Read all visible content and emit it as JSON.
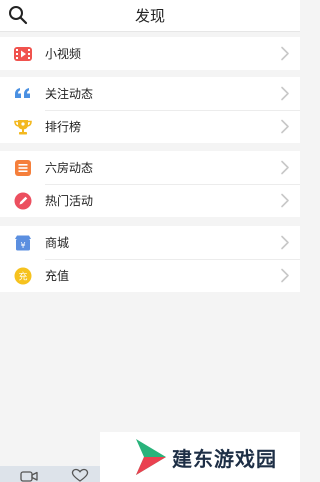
{
  "header": {
    "title": "发现"
  },
  "groups": [
    {
      "items": [
        {
          "label": "小视频",
          "icon": "video-icon"
        }
      ]
    },
    {
      "items": [
        {
          "label": "关注动态",
          "icon": "quote-icon"
        },
        {
          "label": "排行榜",
          "icon": "trophy-icon"
        }
      ]
    },
    {
      "items": [
        {
          "label": "六房动态",
          "icon": "list-icon"
        },
        {
          "label": "热门活动",
          "icon": "pencil-icon"
        }
      ]
    },
    {
      "items": [
        {
          "label": "商城",
          "icon": "shop-icon"
        },
        {
          "label": "充值",
          "icon": "recharge-icon"
        }
      ]
    }
  ],
  "icons": {
    "shop_glyph": "¥",
    "recharge_glyph": "充"
  },
  "watermark": {
    "text": "建东游戏园"
  },
  "colors": {
    "video": "#f0534e",
    "quote": "#4a90e2",
    "trophy": "#f3b81f",
    "list": "#f57f3b",
    "pencil": "#ec4f5f",
    "shop": "#5b8fe0",
    "recharge": "#f6c21e",
    "chevron": "#c8c8c8",
    "watermark_green": "#29b37b",
    "watermark_red": "#ea4150"
  }
}
